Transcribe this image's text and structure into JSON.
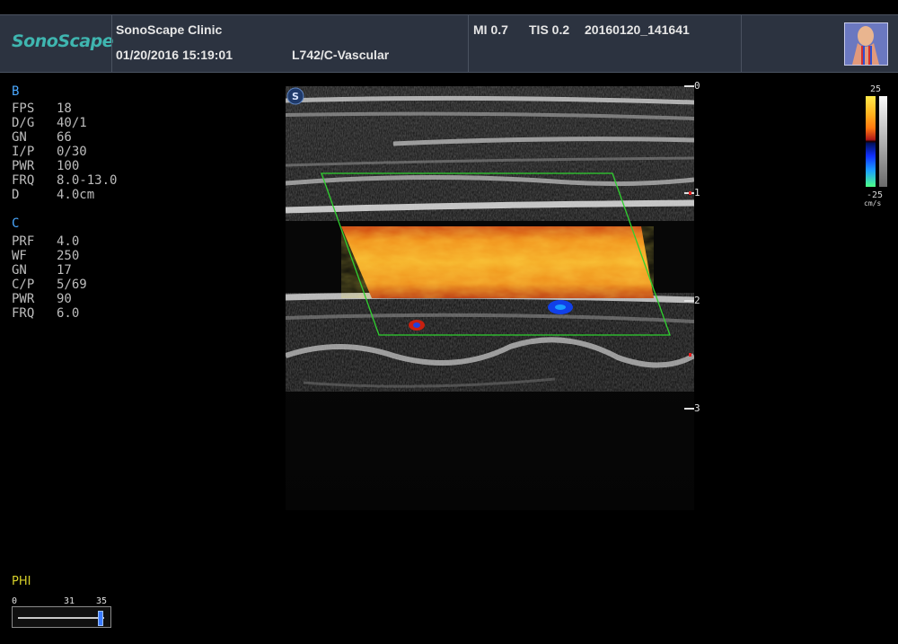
{
  "header": {
    "logo": "SonoScape",
    "clinic": "SonoScape Clinic",
    "datetime": "01/20/2016 15:19:01",
    "preset": "L742/C-Vascular",
    "mi": "MI  0.7",
    "tis": "TIS 0.2",
    "file_id": "20160120_141641"
  },
  "b_mode": {
    "label": "B",
    "params": [
      {
        "key": "FPS",
        "value": "18"
      },
      {
        "key": "D/G",
        "value": "40/1"
      },
      {
        "key": "GN",
        "value": "66"
      },
      {
        "key": "I/P",
        "value": "0/30"
      },
      {
        "key": "PWR",
        "value": "100"
      },
      {
        "key": "FRQ",
        "value": "8.0-13.0"
      },
      {
        "key": "D",
        "value": "4.0cm"
      }
    ]
  },
  "c_mode": {
    "label": "C",
    "params": [
      {
        "key": "PRF",
        "value": "4.0"
      },
      {
        "key": "WF",
        "value": "250"
      },
      {
        "key": "GN",
        "value": "17"
      },
      {
        "key": "C/P",
        "value": "5/69"
      },
      {
        "key": "PWR",
        "value": "90"
      },
      {
        "key": "FRQ",
        "value": "6.0"
      }
    ]
  },
  "depth_scale": {
    "labels": [
      "0",
      "1",
      "2",
      "3"
    ]
  },
  "color_scale": {
    "max": "25",
    "min": "-25",
    "unit": "cm/s"
  },
  "phi": {
    "label": "PHI",
    "min": "0",
    "mid": "31",
    "max": "35",
    "value": 33,
    "range_max": 35
  },
  "image_badge": "S",
  "colors": {
    "header_bg": "#2c3340",
    "logo": "#3fb6b0",
    "mode_label": "#4aa8ff",
    "phi_label": "#d8d22a",
    "roi_box": "#2fd12f"
  }
}
